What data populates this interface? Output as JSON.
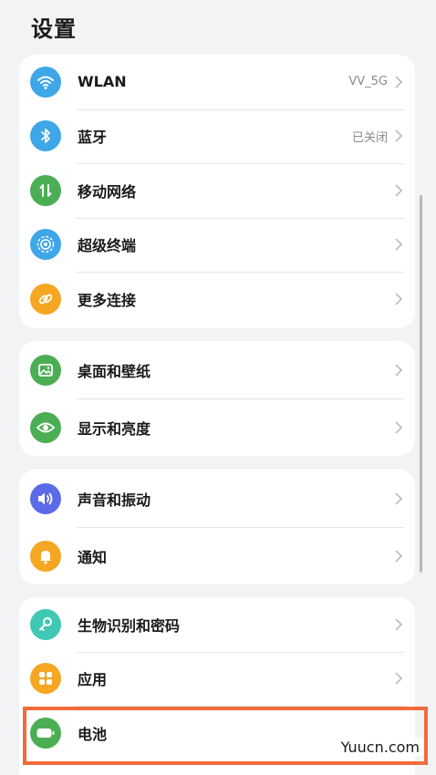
{
  "header": {
    "title": "设置"
  },
  "groups": [
    {
      "items": [
        {
          "label": "WLAN",
          "value": "VV_5G",
          "icon": "wifi-icon",
          "color": "#3fa6e8"
        },
        {
          "label": "蓝牙",
          "value": "已关闭",
          "icon": "bluetooth-icon",
          "color": "#3fa6e8"
        },
        {
          "label": "移动网络",
          "value": "",
          "icon": "mobile-data-icon",
          "color": "#4cae54"
        },
        {
          "label": "超级终端",
          "value": "",
          "icon": "super-device-icon",
          "color": "#3fa6e8"
        },
        {
          "label": "更多连接",
          "value": "",
          "icon": "link-icon",
          "color": "#f5a623"
        }
      ]
    },
    {
      "items": [
        {
          "label": "桌面和壁纸",
          "value": "",
          "icon": "wallpaper-icon",
          "color": "#4cae54"
        },
        {
          "label": "显示和亮度",
          "value": "",
          "icon": "eye-icon",
          "color": "#4cae54"
        }
      ]
    },
    {
      "items": [
        {
          "label": "声音和振动",
          "value": "",
          "icon": "speaker-icon",
          "color": "#5b6ae8"
        },
        {
          "label": "通知",
          "value": "",
          "icon": "bell-icon",
          "color": "#f5a623"
        }
      ]
    },
    {
      "items": [
        {
          "label": "生物识别和密码",
          "value": "",
          "icon": "key-icon",
          "color": "#3fc8b4"
        },
        {
          "label": "应用",
          "value": "",
          "icon": "apps-icon",
          "color": "#f5a623"
        },
        {
          "label": "电池",
          "value": "",
          "icon": "battery-icon",
          "color": "#4cae54"
        }
      ]
    }
  ],
  "highlight": {
    "color": "#f26b3a"
  },
  "watermark": {
    "text": "Yuucn.com"
  }
}
